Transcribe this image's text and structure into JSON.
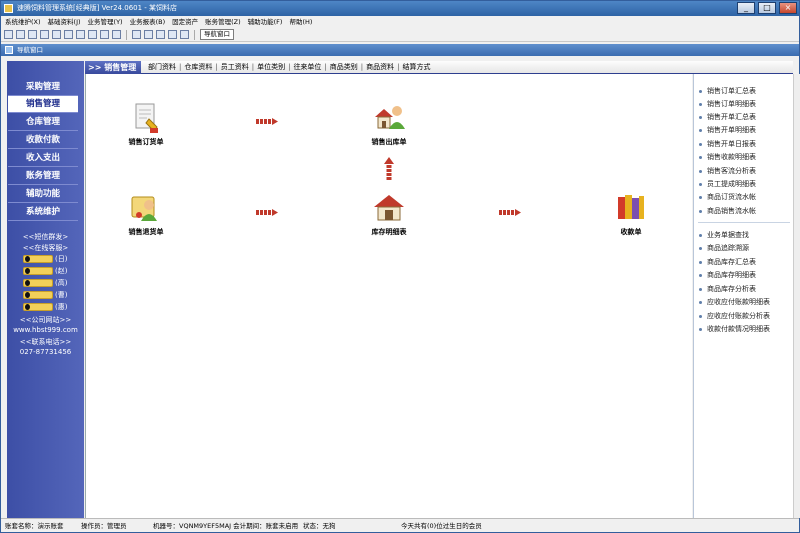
{
  "window": {
    "title": "速腾饲料管理系统[经典版] Ver24.0601 - 某饲料店",
    "buttons": [
      "_",
      "□",
      "×"
    ]
  },
  "menubar": [
    "系统维护(X)",
    "基础资料(J)",
    "业务管理(Y)",
    "业务报表(B)",
    "固定资产",
    "账务管理(Z)",
    "辅助功能(F)",
    "帮助(H)"
  ],
  "toolbar": {
    "nav_button": "导航窗口"
  },
  "nav_tab": "导航窗口",
  "left_menu": [
    {
      "label": "采购管理",
      "active": false
    },
    {
      "label": "销售管理",
      "active": true
    },
    {
      "label": "仓库管理",
      "active": false
    },
    {
      "label": "收款付款",
      "active": false
    },
    {
      "label": "收入支出",
      "active": false
    },
    {
      "label": "账务管理",
      "active": false
    },
    {
      "label": "辅助功能",
      "active": false
    },
    {
      "label": "系统维护",
      "active": false
    }
  ],
  "left_links": {
    "sms": "<<短信群发>",
    "online": "<<在线客服>",
    "qq": [
      "(日)",
      "(赵)",
      "(高)",
      "(曹)",
      "(惠)"
    ],
    "site_label": "<<公司网站>>",
    "site_url": "www.hbst999.com",
    "phone_label": "<<联系电话>>",
    "phone": "027-87731456"
  },
  "subnav": {
    "head": ">> 销售管理",
    "items": [
      "部门资料",
      "仓库资料",
      "员工资料",
      "单位类别",
      "往来单位",
      "商品类别",
      "商品资料",
      "结算方式"
    ]
  },
  "flow": {
    "order": "销售订货单",
    "outbound": "销售出库单",
    "return": "销售退货单",
    "inventory": "库存明细表",
    "receipt": "收款单"
  },
  "right_group1": [
    "销售订单汇总表",
    "销售订单明细表",
    "销售开单汇总表",
    "销售开单明细表",
    "销售开单日报表",
    "销售收款明细表",
    "销售客流分析表",
    "员工提成明细表",
    "商品订货流水帐",
    "商品销售流水帐"
  ],
  "right_group2": [
    "业务单据查找",
    "商品追踪溯源",
    "商品库存汇总表",
    "商品库存明细表",
    "商品库存分析表",
    "应收应付账款明细表",
    "应收应付账款分析表",
    "收款付款情况明细表"
  ],
  "statusbar": {
    "account": "账套名称：演示账套",
    "operator": "操作员：管理员",
    "machine": "机器号：VQNM9YEF5MAJ 会计期间：账套未启用",
    "state": "状态：无狗",
    "birthday": "今天共有(0)位过生日的会员"
  },
  "colors": {
    "title_bar": "#2e63a5",
    "left_bar": "#4455ac",
    "arrow": "#c0392b"
  }
}
